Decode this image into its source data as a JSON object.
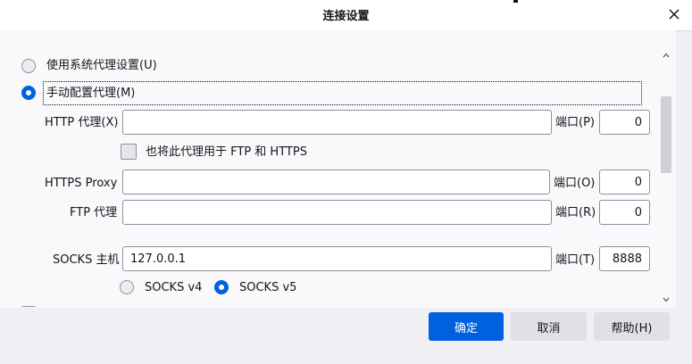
{
  "window": {
    "title": "连接设置"
  },
  "options": {
    "system_proxy": "使用系统代理设置(U)",
    "manual_proxy": "手动配置代理(M)"
  },
  "http": {
    "label": "HTTP 代理(X)",
    "value": "",
    "port_label": "端口(P)",
    "port": "0"
  },
  "also_use_for": "也将此代理用于 FTP 和 HTTPS",
  "https": {
    "label": "HTTPS Proxy",
    "value": "",
    "port_label": "端口(O)",
    "port": "0"
  },
  "ftp": {
    "label": "FTP 代理",
    "value": "",
    "port_label": "端口(R)",
    "port": "0"
  },
  "socks": {
    "label": "SOCKS 主机",
    "value": "127.0.0.1",
    "port_label": "端口(T)",
    "port": "8888",
    "v4": "SOCKS v4",
    "v5": "SOCKS v5"
  },
  "buttons": {
    "ok": "确定",
    "cancel": "取消",
    "help": "帮助(H)"
  },
  "colors": {
    "accent": "#0061e0",
    "background": "#f9f9fb",
    "footer": "#f0f0f4"
  }
}
